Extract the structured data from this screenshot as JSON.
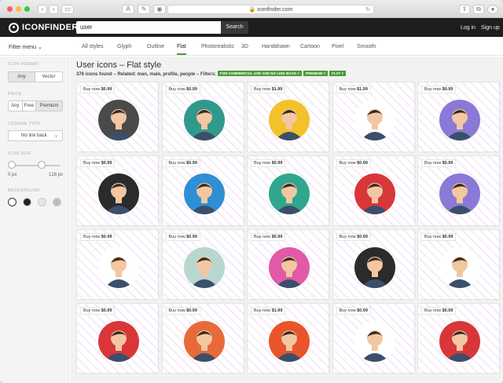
{
  "browser": {
    "url": "iconfinder.com",
    "reader_label": "A"
  },
  "header": {
    "brand": "ICONFINDER",
    "search_value": "user",
    "search_button": "Search",
    "login": "Log in",
    "signup": "Sign up"
  },
  "filterbar": {
    "filter_menu": "Filter menu",
    "styles": [
      "All styles",
      "Glyph",
      "Outline",
      "Flat",
      "Photorealistic",
      "3D",
      "Handdrawn",
      "Cartoon",
      "Pixel",
      "Smooth"
    ],
    "active_style": "Flat"
  },
  "sidebar": {
    "icon_format": {
      "heading": "ICON FORMAT",
      "options": [
        "Any",
        "Vector"
      ],
      "selected": "Any"
    },
    "price": {
      "heading": "PRICE",
      "options": [
        "Any",
        "Free",
        "Premium"
      ],
      "selected": "Premium"
    },
    "license": {
      "heading": "LICENSE TYPE",
      "value": "No link back"
    },
    "icon_size": {
      "heading": "ICON SIZE",
      "min": "0 px",
      "max": "128 px"
    },
    "background": {
      "heading": "BACKGROUND",
      "swatches": [
        "#ffffff",
        "#222222",
        "#e6e6e6",
        "#bdbdbd"
      ],
      "selected": 0
    }
  },
  "results": {
    "title": "User icons – Flat style",
    "summary": "376 icons found – Related: man, male, profile, people – Filters:",
    "filters": [
      "FOR COMMERCIAL USE AND NO LINK BACK",
      "PREMIUM",
      "FLAT"
    ],
    "cards": [
      {
        "label": "Buy now",
        "price": "$0.99",
        "icon": "id-card-icon",
        "bg": "#4a4a4a"
      },
      {
        "label": "Buy now",
        "price": "$0.99",
        "icon": "businessman-glasses-icon",
        "bg": "#2f9a8c"
      },
      {
        "label": "Buy now",
        "price": "$1.99",
        "icon": "profile-card-icon",
        "bg": "#f3c12b"
      },
      {
        "label": "Buy now",
        "price": "$1.99",
        "icon": "group-people-icon",
        "bg": "#ffffff"
      },
      {
        "label": "Buy now",
        "price": "$0.99",
        "icon": "man-tie-icon",
        "bg": "#8a79d6"
      },
      {
        "label": "Buy now",
        "price": "$0.99",
        "icon": "worker-helmet-icon",
        "bg": "#2b2b2b"
      },
      {
        "label": "Buy now",
        "price": "$0.99",
        "icon": "bearded-man-icon",
        "bg": "#2e8fd4"
      },
      {
        "label": "Buy now",
        "price": "$0.99",
        "icon": "old-woman-icon",
        "bg": "#2fa78e"
      },
      {
        "label": "Buy now",
        "price": "$0.99",
        "icon": "woman-afro-icon",
        "bg": "#d9363a"
      },
      {
        "label": "Buy now",
        "price": "$0.99",
        "icon": "woman-blonde-icon",
        "bg": "#8a79d6"
      },
      {
        "label": "Buy now",
        "price": "$0.49",
        "icon": "couple-icon",
        "bg": "#ffffff"
      },
      {
        "label": "Buy now",
        "price": "$0.99",
        "icon": "nerd-boy-icon",
        "bg": "#b8d8cf"
      },
      {
        "label": "Buy now",
        "price": "$0.99",
        "icon": "woman-bun-icon",
        "bg": "#e05aa8"
      },
      {
        "label": "Buy now",
        "price": "$0.99",
        "icon": "woman-yellow-hair-icon",
        "bg": "#2b2b2b"
      },
      {
        "label": "Buy now",
        "price": "$0.99",
        "icon": "nurse-icon",
        "bg": "#ffffff"
      },
      {
        "label": "Buy now",
        "price": "$0.99",
        "icon": "punk-man-icon",
        "bg": "#d9363a"
      },
      {
        "label": "Buy now",
        "price": "$0.99",
        "icon": "man-suit-icon",
        "bg": "#e86a3a"
      },
      {
        "label": "Buy now",
        "price": "$1.99",
        "icon": "devices-icon",
        "bg": "#e8552a"
      },
      {
        "label": "Buy now",
        "price": "$0.99",
        "icon": "spy-icon",
        "bg": "#ffffff"
      },
      {
        "label": "Buy now",
        "price": "$0.99",
        "icon": "athlete-icon",
        "bg": "#d9363a"
      }
    ]
  }
}
